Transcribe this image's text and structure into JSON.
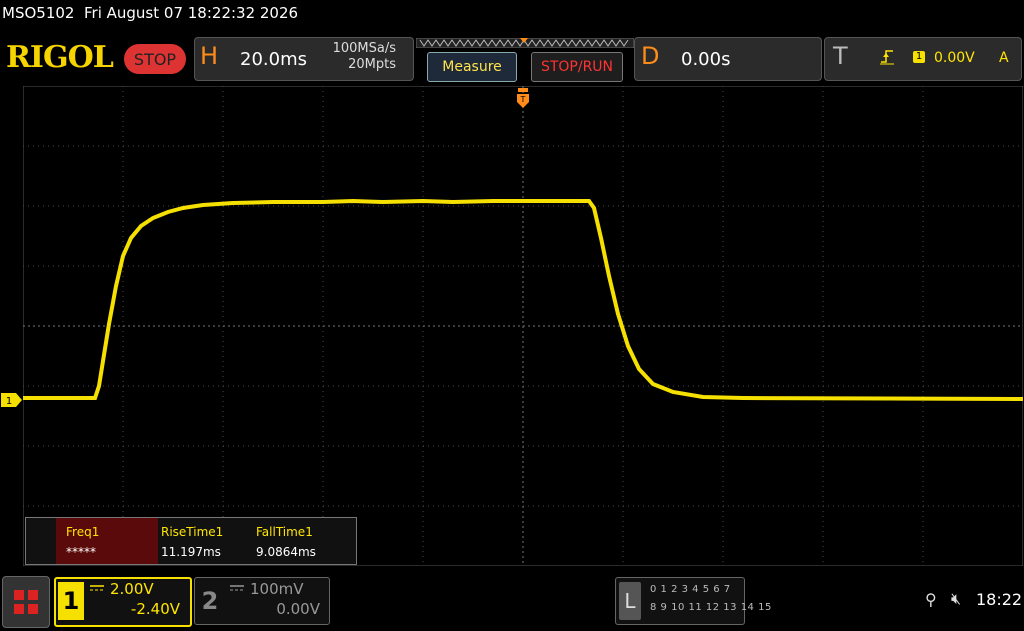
{
  "status_bar": {
    "model": "MSO5102",
    "datetime": "Fri August 07 18:22:32 2026"
  },
  "header": {
    "logo": "RIGOL",
    "run_state": "STOP",
    "horizontal": {
      "letter": "H",
      "timebase": "20.0ms",
      "sample_rate": "100MSa/s",
      "memory_depth": "20Mpts"
    },
    "measure_button": "Measure",
    "stop_run_button": "STOP/RUN",
    "delay": {
      "letter": "D",
      "value": "0.00s"
    },
    "trigger": {
      "letter": "T",
      "source": "1",
      "level": "0.00V",
      "mode": "A"
    }
  },
  "channel_marker": "1",
  "measurements": {
    "headers": [
      "Freq1",
      "RiseTime1",
      "FallTime1"
    ],
    "values": [
      "*****",
      "11.197ms",
      "9.0864ms"
    ]
  },
  "channels": [
    {
      "number": "1",
      "scale": "2.00V",
      "offset": "-2.40V",
      "active": true
    },
    {
      "number": "2",
      "scale": "100mV",
      "offset": "0.00V",
      "active": false
    }
  ],
  "logic_analyzer": {
    "letter": "L",
    "row1": "0 1 2 3  4 5 6 7",
    "row2": "8 9 10 11 12 13 14 15"
  },
  "system_tray": {
    "usb_icon": "usb-icon",
    "speaker_icon": "speaker-muted-icon",
    "time": "18:22"
  },
  "colors": {
    "ch1": "#f5e000",
    "accent_orange": "#ff8c1a",
    "stop_red": "#dd3333"
  }
}
